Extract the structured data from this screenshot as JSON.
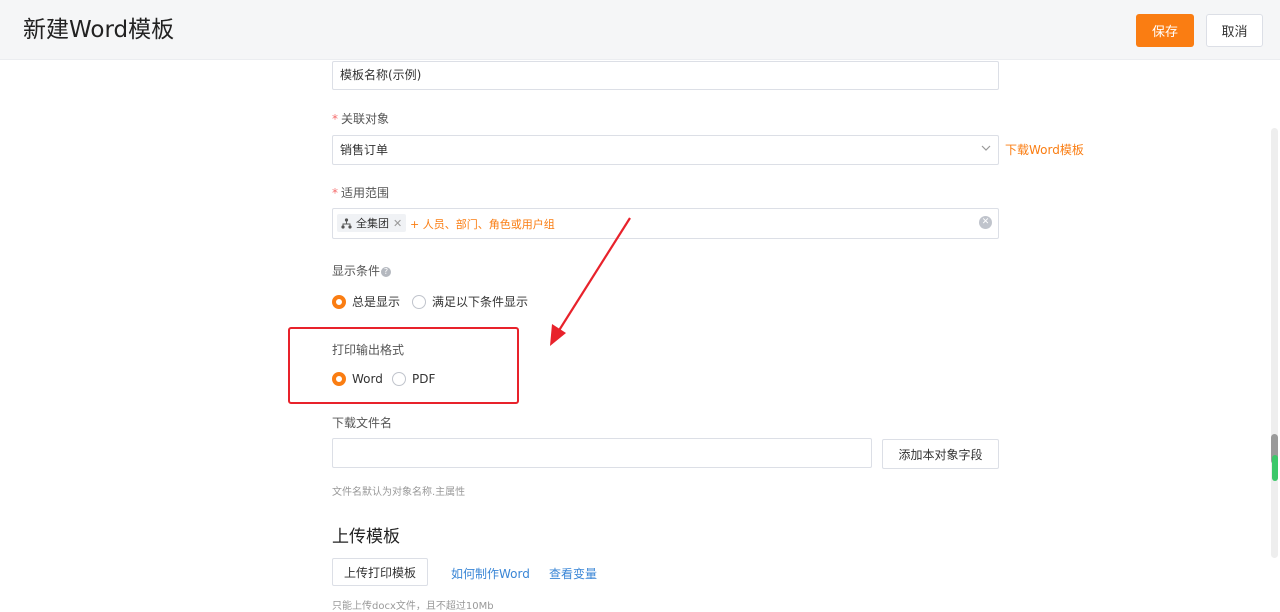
{
  "header": {
    "title": "新建Word模板",
    "save_label": "保存",
    "cancel_label": "取消"
  },
  "form": {
    "template_name": {
      "value": "模板名称(示例)"
    },
    "related_object": {
      "label": "关联对象",
      "value": "销售订单",
      "download_link": "下载Word模板"
    },
    "scope": {
      "label": "适用范围",
      "tag": "全集团",
      "add_label": "+ 人员、部门、角色或用户组"
    },
    "display_condition": {
      "label": "显示条件",
      "options": [
        "总是显示",
        "满足以下条件显示"
      ],
      "selected": "总是显示"
    },
    "print_format": {
      "label": "打印输出格式",
      "options": [
        "Word",
        "PDF"
      ],
      "selected": "Word"
    },
    "download_filename": {
      "label": "下载文件名",
      "value": "",
      "add_field_label": "添加本对象字段",
      "hint": "文件名默认为对象名称.主属性"
    },
    "upload": {
      "title": "上传模板",
      "upload_button": "上传打印模板",
      "how_to_link": "如何制作Word",
      "view_vars_link": "查看变量",
      "hint": "只能上传docx文件，且不超过10Mb"
    }
  },
  "colors": {
    "accent": "#fa7d12",
    "highlight": "#e8222b",
    "link": "#3a86d6"
  },
  "icons": {
    "chevron": "chevron-down-icon",
    "org": "org-tree-icon",
    "clear": "clear-icon",
    "help": "question-icon"
  }
}
